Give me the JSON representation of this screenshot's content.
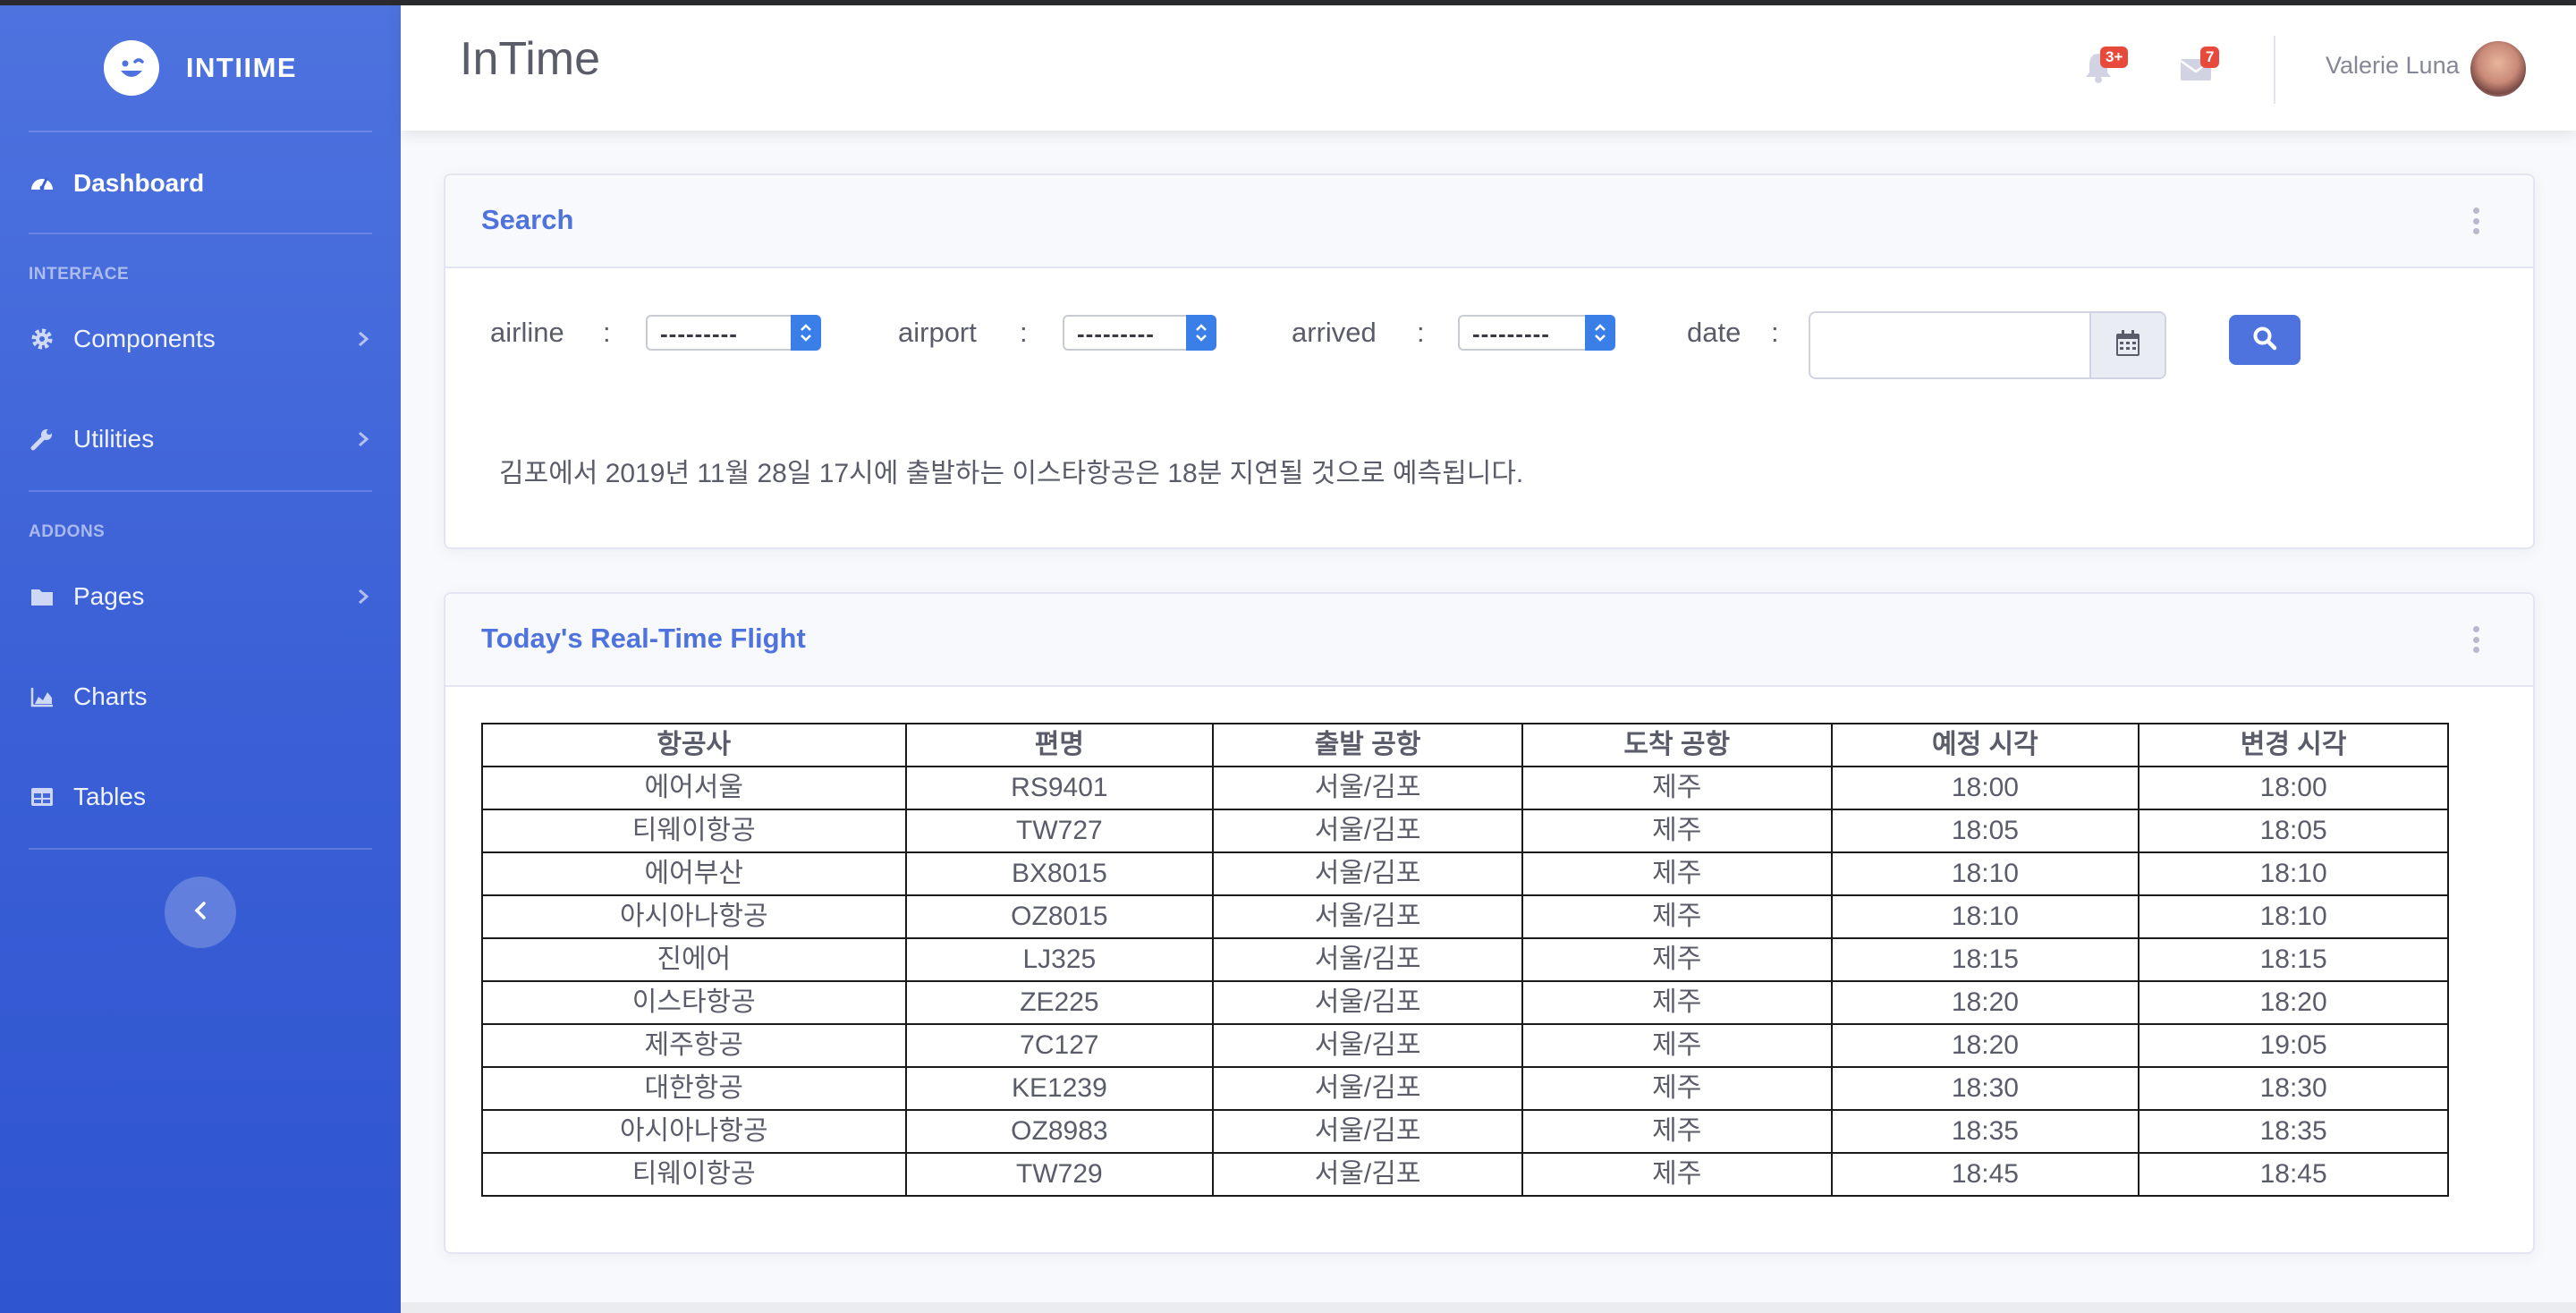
{
  "sidebar": {
    "brand": "INTIIME",
    "dashboard": "Dashboard",
    "section_interface": "INTERFACE",
    "components": "Components",
    "utilities": "Utilities",
    "section_addons": "ADDONS",
    "pages": "Pages",
    "charts": "Charts",
    "tables": "Tables"
  },
  "topbar": {
    "title": "InTime",
    "alerts_badge": "3+",
    "messages_badge": "7",
    "user_name": "Valerie Luna"
  },
  "search_card": {
    "title": "Search",
    "fields": {
      "airline_label": "airline",
      "airline_value": "---------",
      "airport_label": "airport",
      "airport_value": "---------",
      "arrived_label": "arrived",
      "arrived_value": "---------",
      "date_label": "date",
      "date_value": "",
      "colon": ":"
    },
    "prediction": "김포에서 2019년 11월 28일 17시에 출발하는 이스타항공은 18분 지연될 것으로 예측됩니다."
  },
  "flights_card": {
    "title": "Today's Real-Time Flight",
    "columns": [
      "항공사",
      "편명",
      "출발 공항",
      "도착 공항",
      "예정 시각",
      "변경 시각"
    ],
    "rows": [
      [
        "에어서울",
        "RS9401",
        "서울/김포",
        "제주",
        "18:00",
        "18:00"
      ],
      [
        "티웨이항공",
        "TW727",
        "서울/김포",
        "제주",
        "18:05",
        "18:05"
      ],
      [
        "에어부산",
        "BX8015",
        "서울/김포",
        "제주",
        "18:10",
        "18:10"
      ],
      [
        "아시아나항공",
        "OZ8015",
        "서울/김포",
        "제주",
        "18:10",
        "18:10"
      ],
      [
        "진에어",
        "LJ325",
        "서울/김포",
        "제주",
        "18:15",
        "18:15"
      ],
      [
        "이스타항공",
        "ZE225",
        "서울/김포",
        "제주",
        "18:20",
        "18:20"
      ],
      [
        "제주항공",
        "7C127",
        "서울/김포",
        "제주",
        "18:20",
        "19:05"
      ],
      [
        "대한항공",
        "KE1239",
        "서울/김포",
        "제주",
        "18:30",
        "18:30"
      ],
      [
        "아시아나항공",
        "OZ8983",
        "서울/김포",
        "제주",
        "18:35",
        "18:35"
      ],
      [
        "티웨이항공",
        "TW729",
        "서울/김포",
        "제주",
        "18:45",
        "18:45"
      ]
    ]
  },
  "colors": {
    "primary": "#4e73df",
    "badge": "#e74a3b",
    "text": "#5a5c69"
  }
}
